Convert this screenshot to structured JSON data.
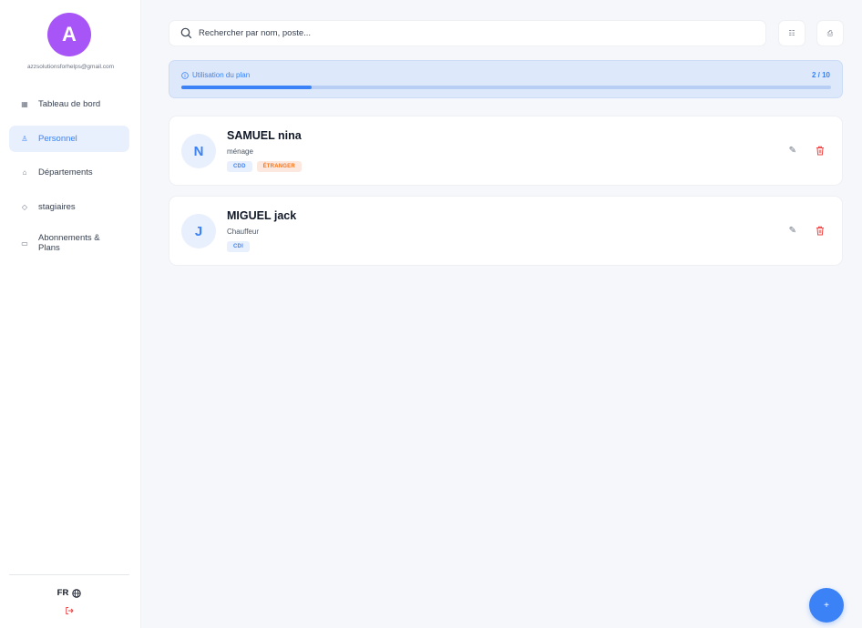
{
  "user": {
    "initial": "A",
    "email": "azzsolutionsforhelps@gmail.com"
  },
  "sidebar": {
    "items": [
      {
        "label": "Tableau de bord",
        "icon": "grid-icon"
      },
      {
        "label": "Personnel",
        "icon": "users-icon",
        "active": true
      },
      {
        "label": "Départements",
        "icon": "building-icon"
      },
      {
        "label": "stagiaires",
        "icon": "graduation-cap-icon"
      },
      {
        "label": "Abonnements & Plans",
        "icon": "card-icon"
      }
    ],
    "language": "FR"
  },
  "search": {
    "placeholder": "Rechercher par nom, poste..."
  },
  "plan": {
    "title": "Utilisation du plan",
    "count": "2 / 10",
    "used": 2,
    "max": 10
  },
  "employees": [
    {
      "initial": "N",
      "name": "SAMUEL nina",
      "role": "ménage",
      "tags": [
        "CDD",
        "ÉTRANGER"
      ]
    },
    {
      "initial": "J",
      "name": "MIGUEL jack",
      "role": "Chauffeur",
      "tags": [
        "CDI"
      ]
    }
  ],
  "colors": {
    "primary": "#3b82f6",
    "avatar": "#a855f7",
    "danger": "#ef4444",
    "warning": "#f97316"
  }
}
